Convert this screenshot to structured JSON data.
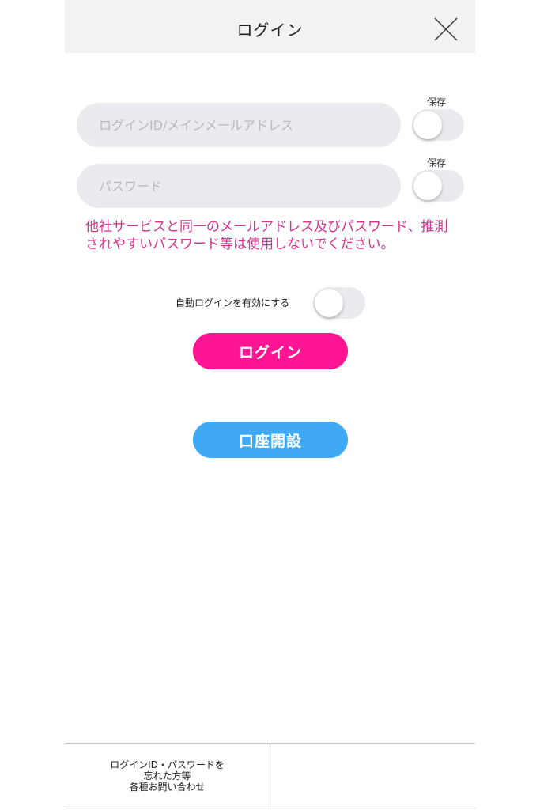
{
  "header": {
    "title": "ログイン"
  },
  "form": {
    "id_placeholder": "ログインID/メインメールアドレス",
    "password_placeholder": "パスワード",
    "save_label": "保存"
  },
  "warning": "他社サービスと同一のメールアドレス及びパスワード、推測されやすいパスワード等は使用しないでください。",
  "auto_login_label": "自動ログインを有効にする",
  "buttons": {
    "login": "ログイン",
    "open_account": "口座開設"
  },
  "footer": {
    "forgot_line1": "ログインID・パスワードを",
    "forgot_line2": "忘れた方等",
    "forgot_line3": "各種お問い合わせ"
  },
  "colors": {
    "login_button": "#ff1493",
    "open_account_button": "#3fa9f5",
    "warning_text": "#d6338f"
  },
  "toggles": {
    "save_id": false,
    "save_password": false,
    "auto_login": false
  }
}
